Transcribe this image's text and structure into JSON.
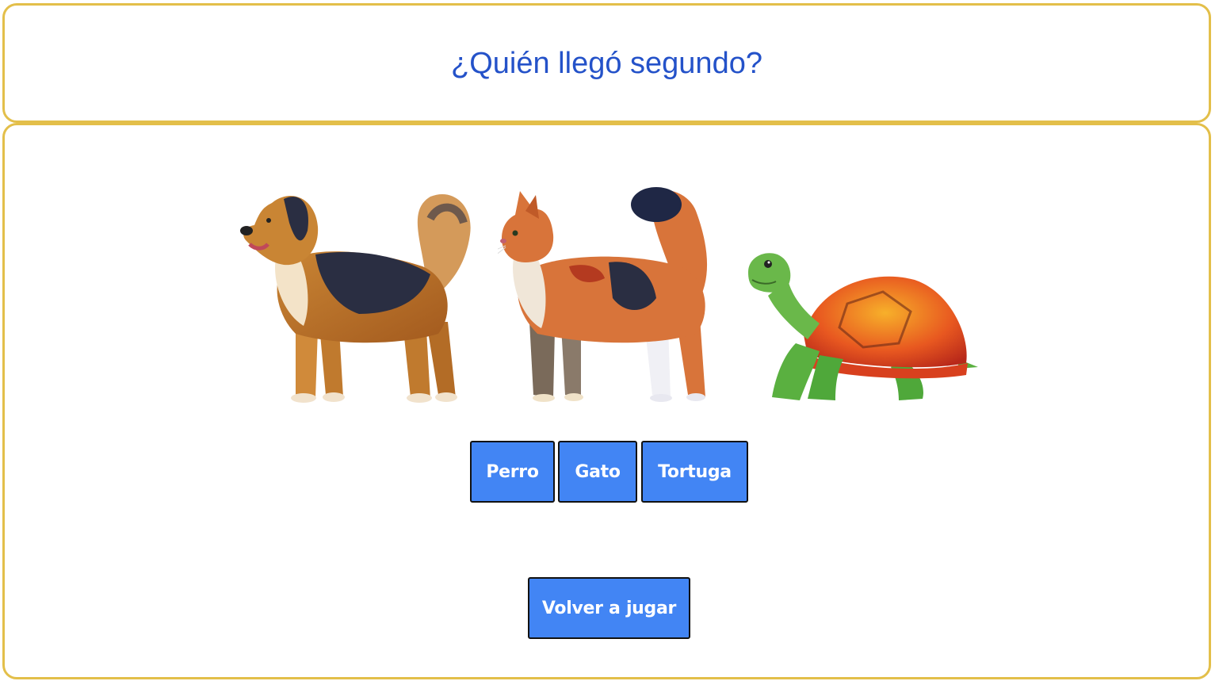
{
  "question": {
    "title": "¿Quién llegó segundo?"
  },
  "race": {
    "animals": [
      {
        "icon": "dog-icon"
      },
      {
        "icon": "cat-icon"
      },
      {
        "icon": "turtle-icon"
      }
    ]
  },
  "answers": {
    "options": [
      "Perro",
      "Gato",
      "Tortuga"
    ]
  },
  "controls": {
    "replay_label": "Volver a jugar"
  },
  "colors": {
    "border": "#e3bf4a",
    "title": "#2452c9",
    "button": "#4285f4"
  }
}
